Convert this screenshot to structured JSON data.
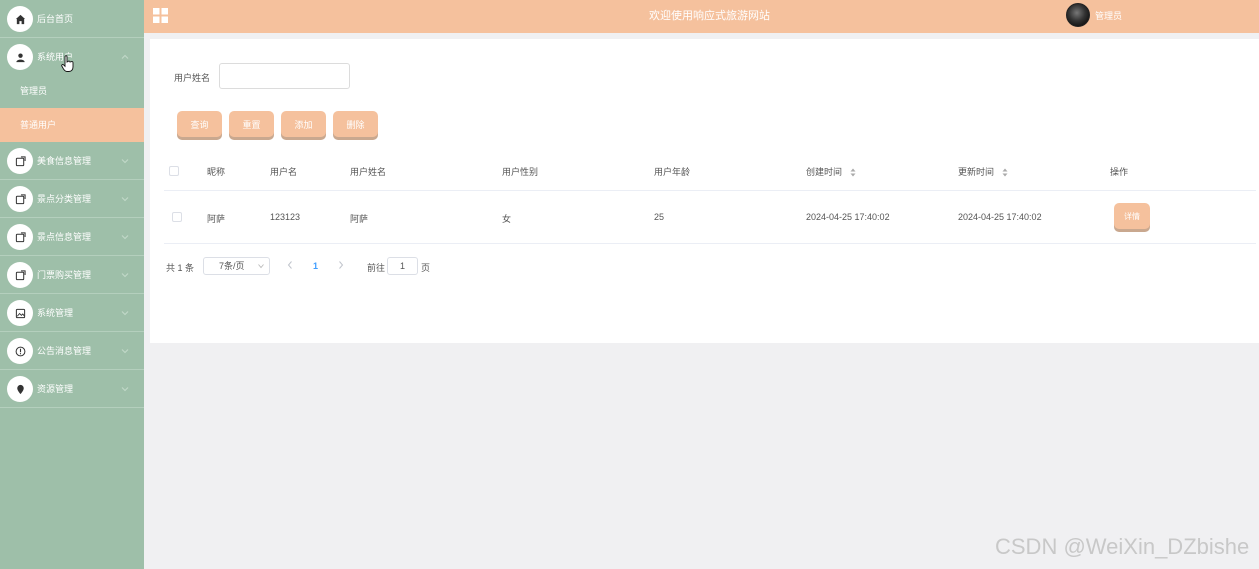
{
  "sidebar": {
    "items": [
      {
        "label": "后台首页",
        "icon": "home-icon"
      },
      {
        "label": "系统用户",
        "icon": "user-icon",
        "expanded": true,
        "children": [
          {
            "label": "管理员"
          },
          {
            "label": "普通用户",
            "active": true
          }
        ]
      },
      {
        "label": "美食信息管理",
        "icon": "external-link-icon"
      },
      {
        "label": "景点分类管理",
        "icon": "external-link-icon"
      },
      {
        "label": "景点信息管理",
        "icon": "external-link-icon"
      },
      {
        "label": "门票购买管理",
        "icon": "external-link-icon"
      },
      {
        "label": "系统管理",
        "icon": "image-icon"
      },
      {
        "label": "公告消息管理",
        "icon": "info-icon"
      },
      {
        "label": "资源管理",
        "icon": "location-icon"
      }
    ]
  },
  "header": {
    "title": "欢迎使用响应式旅游网站",
    "user": "管理员"
  },
  "search": {
    "label": "用户姓名",
    "value": "",
    "placeholder": ""
  },
  "buttons": {
    "query": "查询",
    "reset": "重置",
    "add": "添加",
    "delete": "删除"
  },
  "table": {
    "headers": [
      "昵称",
      "用户名",
      "用户姓名",
      "用户性别",
      "用户年龄",
      "创建时间",
      "更新时间",
      "操作"
    ],
    "rows": [
      {
        "nickname": "阿萨",
        "username": "123123",
        "realname": "阿萨",
        "gender": "女",
        "age": "25",
        "created": "2024-04-25 17:40:02",
        "updated": "2024-04-25 17:40:02",
        "action": "详情"
      }
    ]
  },
  "pagination": {
    "total": "共 1 条",
    "page_size": "7条/页",
    "current": "1",
    "goto_label": "前往",
    "goto_value": "1",
    "page_suffix": "页"
  },
  "watermark": "CSDN @WeiXin_DZbishe",
  "colors": {
    "sidebar_bg": "#9ebfa9",
    "accent": "#f5c19d",
    "link": "#409eff"
  }
}
